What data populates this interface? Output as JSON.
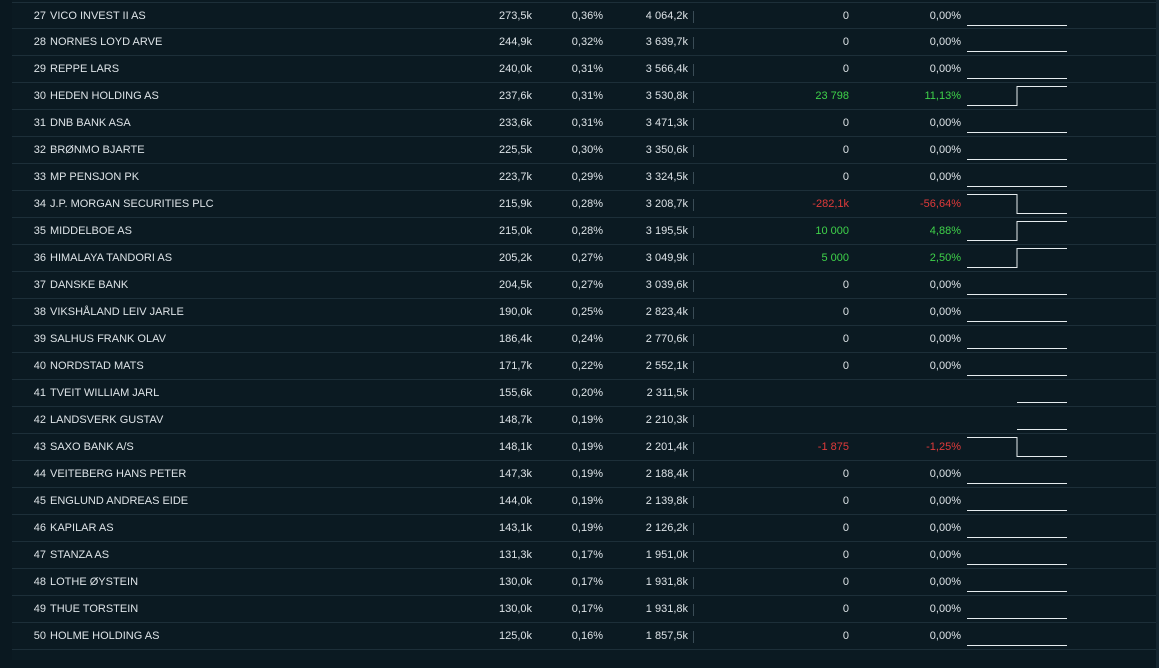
{
  "colors": {
    "background": "#0b1a22",
    "text": "#dde3e7",
    "positive": "#3fd24a",
    "negative": "#e03a3a",
    "row_border": "#1d2f39"
  },
  "rows": [
    {
      "rank": "27",
      "name": "VICO INVEST II AS",
      "shares": "273,5k",
      "pct": "0,36%",
      "value": "4 064,2k",
      "change": "0",
      "change_pct": "0,00%",
      "trend": "flat"
    },
    {
      "rank": "28",
      "name": "NORNES LOYD ARVE",
      "shares": "244,9k",
      "pct": "0,32%",
      "value": "3 639,7k",
      "change": "0",
      "change_pct": "0,00%",
      "trend": "flat"
    },
    {
      "rank": "29",
      "name": "REPPE LARS",
      "shares": "240,0k",
      "pct": "0,31%",
      "value": "3 566,4k",
      "change": "0",
      "change_pct": "0,00%",
      "trend": "flat"
    },
    {
      "rank": "30",
      "name": "HEDEN HOLDING AS",
      "shares": "237,6k",
      "pct": "0,31%",
      "value": "3 530,8k",
      "change": "23 798",
      "change_pct": "11,13%",
      "trend": "up"
    },
    {
      "rank": "31",
      "name": "DNB BANK ASA",
      "shares": "233,6k",
      "pct": "0,31%",
      "value": "3 471,3k",
      "change": "0",
      "change_pct": "0,00%",
      "trend": "flat"
    },
    {
      "rank": "32",
      "name": "BRØNMO BJARTE",
      "shares": "225,5k",
      "pct": "0,30%",
      "value": "3 350,6k",
      "change": "0",
      "change_pct": "0,00%",
      "trend": "flat"
    },
    {
      "rank": "33",
      "name": "MP PENSJON PK",
      "shares": "223,7k",
      "pct": "0,29%",
      "value": "3 324,5k",
      "change": "0",
      "change_pct": "0,00%",
      "trend": "flat"
    },
    {
      "rank": "34",
      "name": "J.P. MORGAN SECURITIES PLC",
      "shares": "215,9k",
      "pct": "0,28%",
      "value": "3 208,7k",
      "change": "-282,1k",
      "change_pct": "-56,64%",
      "trend": "down"
    },
    {
      "rank": "35",
      "name": "MIDDELBOE AS",
      "shares": "215,0k",
      "pct": "0,28%",
      "value": "3 195,5k",
      "change": "10 000",
      "change_pct": "4,88%",
      "trend": "up"
    },
    {
      "rank": "36",
      "name": "HIMALAYA TANDORI AS",
      "shares": "205,2k",
      "pct": "0,27%",
      "value": "3 049,9k",
      "change": "5 000",
      "change_pct": "2,50%",
      "trend": "up"
    },
    {
      "rank": "37",
      "name": "DANSKE BANK",
      "shares": "204,5k",
      "pct": "0,27%",
      "value": "3 039,6k",
      "change": "0",
      "change_pct": "0,00%",
      "trend": "flat"
    },
    {
      "rank": "38",
      "name": "VIKSHÅLAND LEIV JARLE",
      "shares": "190,0k",
      "pct": "0,25%",
      "value": "2 823,4k",
      "change": "0",
      "change_pct": "0,00%",
      "trend": "flat"
    },
    {
      "rank": "39",
      "name": "SALHUS FRANK OLAV",
      "shares": "186,4k",
      "pct": "0,24%",
      "value": "2 770,6k",
      "change": "0",
      "change_pct": "0,00%",
      "trend": "flat"
    },
    {
      "rank": "40",
      "name": "NORDSTAD MATS",
      "shares": "171,7k",
      "pct": "0,22%",
      "value": "2 552,1k",
      "change": "0",
      "change_pct": "0,00%",
      "trend": "flat"
    },
    {
      "rank": "41",
      "name": "TVEIT WILLIAM JARL",
      "shares": "155,6k",
      "pct": "0,20%",
      "value": "2 311,5k",
      "change": "",
      "change_pct": "",
      "trend": "new"
    },
    {
      "rank": "42",
      "name": "LANDSVERK GUSTAV",
      "shares": "148,7k",
      "pct": "0,19%",
      "value": "2 210,3k",
      "change": "",
      "change_pct": "",
      "trend": "new"
    },
    {
      "rank": "43",
      "name": "SAXO BANK A/S",
      "shares": "148,1k",
      "pct": "0,19%",
      "value": "2 201,4k",
      "change": "-1 875",
      "change_pct": "-1,25%",
      "trend": "down"
    },
    {
      "rank": "44",
      "name": "VEITEBERG HANS PETER",
      "shares": "147,3k",
      "pct": "0,19%",
      "value": "2 188,4k",
      "change": "0",
      "change_pct": "0,00%",
      "trend": "flat"
    },
    {
      "rank": "45",
      "name": "ENGLUND ANDREAS EIDE",
      "shares": "144,0k",
      "pct": "0,19%",
      "value": "2 139,8k",
      "change": "0",
      "change_pct": "0,00%",
      "trend": "flat"
    },
    {
      "rank": "46",
      "name": "KAPILAR AS",
      "shares": "143,1k",
      "pct": "0,19%",
      "value": "2 126,2k",
      "change": "0",
      "change_pct": "0,00%",
      "trend": "flat"
    },
    {
      "rank": "47",
      "name": "STANZA AS",
      "shares": "131,3k",
      "pct": "0,17%",
      "value": "1 951,0k",
      "change": "0",
      "change_pct": "0,00%",
      "trend": "flat"
    },
    {
      "rank": "48",
      "name": "LOTHE ØYSTEIN",
      "shares": "130,0k",
      "pct": "0,17%",
      "value": "1 931,8k",
      "change": "0",
      "change_pct": "0,00%",
      "trend": "flat"
    },
    {
      "rank": "49",
      "name": "THUE TORSTEIN",
      "shares": "130,0k",
      "pct": "0,17%",
      "value": "1 931,8k",
      "change": "0",
      "change_pct": "0,00%",
      "trend": "flat"
    },
    {
      "rank": "50",
      "name": "HOLME HOLDING AS",
      "shares": "125,0k",
      "pct": "0,16%",
      "value": "1 857,5k",
      "change": "0",
      "change_pct": "0,00%",
      "trend": "flat"
    }
  ]
}
